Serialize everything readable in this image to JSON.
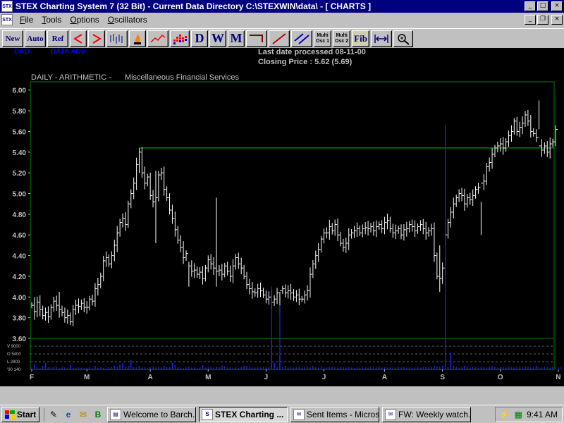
{
  "window": {
    "title": "STEX Charting System 7 (32 Bit)  -  Current Data Directory C:\\STEXWIN\\data\\ - [  CHARTS   ]",
    "min": "_",
    "max": "□",
    "close": "×",
    "doc_min": "_",
    "doc_max": "❐",
    "doc_close": "×"
  },
  "menu": {
    "items": [
      "File",
      "Tools",
      "Options",
      "Oscillators"
    ]
  },
  "toolbar": {
    "new_label": "New",
    "auto_label": "Auto",
    "ref_label": "Ref",
    "d_label": "D",
    "w_label": "W",
    "m_label": "M",
    "multi1_a": "Multi",
    "multi1_b": "Osc 1",
    "multi2_a": "Multi",
    "multi2_b": "Osc 2",
    "fib_label": "Fib"
  },
  "chart_header": {
    "symbol": "DAD",
    "indicator": "DATA ADV",
    "last_date": "Last date processed 08-11-00",
    "closing": "Closing Price : 5.62  (5.69)",
    "mode": "DAILY - ARITHMETIC -",
    "sector": "Miscellaneous Financial Services"
  },
  "colors": {
    "background": "#000000",
    "bars": "#ffffff",
    "grid_frame": "#008000",
    "resistance": "#00c000",
    "volume": "#2020ff",
    "axis_text": "#c0c0c0",
    "header_blue": "#0000ff"
  },
  "chart_data": {
    "type": "ohlc",
    "y_ticks": [
      "6.00",
      "5.80",
      "5.60",
      "5.40",
      "5.20",
      "5.00",
      "4.80",
      "4.60",
      "4.40",
      "4.20",
      "4.00",
      "3.80",
      "3.60"
    ],
    "ylim": [
      3.6,
      6.08
    ],
    "x_months": [
      "F",
      "M",
      "A",
      "M",
      "J",
      "J",
      "A",
      "S",
      "O",
      "N"
    ],
    "month_index": [
      0,
      20,
      43,
      64,
      85,
      106,
      128,
      149,
      170,
      191
    ],
    "resistance_level": 5.44,
    "resistance_start_index": 39,
    "volume_axis_labels": [
      "V 9000",
      "O 5400",
      "L 2800",
      "'00 140"
    ],
    "closes": [
      3.92,
      3.86,
      3.95,
      3.88,
      3.82,
      3.85,
      3.81,
      3.9,
      3.96,
      3.92,
      3.88,
      3.85,
      3.8,
      3.82,
      3.76,
      3.88,
      3.92,
      3.91,
      3.94,
      3.9,
      3.9,
      3.98,
      3.96,
      4.08,
      4.12,
      4.2,
      4.35,
      4.38,
      4.32,
      4.4,
      4.5,
      4.62,
      4.72,
      4.76,
      4.7,
      4.9,
      5.0,
      5.1,
      5.28,
      5.4,
      5.2,
      5.1,
      5.16,
      4.98,
      4.92,
      4.96,
      5.18,
      5.2,
      5.04,
      4.96,
      4.84,
      4.76,
      4.65,
      4.55,
      4.48,
      4.38,
      4.42,
      4.3,
      4.25,
      4.26,
      4.22,
      4.24,
      4.18,
      4.28,
      4.36,
      4.32,
      4.28,
      4.25,
      4.26,
      4.22,
      4.3,
      4.25,
      4.2,
      4.3,
      4.38,
      4.32,
      4.28,
      4.2,
      4.12,
      4.08,
      4.05,
      4.04,
      4.08,
      4.06,
      4.02,
      3.98,
      4.0,
      3.95,
      3.98,
      4.04,
      4.06,
      4.08,
      4.04,
      4.06,
      4.04,
      4.0,
      4.02,
      3.98,
      3.98,
      4.02,
      4.06,
      4.22,
      4.32,
      4.4,
      4.46,
      4.56,
      4.62,
      4.62,
      4.68,
      4.64,
      4.7,
      4.6,
      4.52,
      4.48,
      4.52,
      4.6,
      4.62,
      4.64,
      4.66,
      4.62,
      4.66,
      4.67,
      4.66,
      4.68,
      4.64,
      4.68,
      4.7,
      4.66,
      4.72,
      4.74,
      4.66,
      4.62,
      4.64,
      4.66,
      4.6,
      4.65,
      4.66,
      4.7,
      4.68,
      4.64,
      4.68,
      4.7,
      4.66,
      4.62,
      4.64,
      4.66,
      4.4,
      4.2,
      4.18,
      4.28,
      4.6,
      4.72,
      4.82,
      4.9,
      4.96,
      5.0,
      4.98,
      4.9,
      4.96,
      4.94,
      4.98,
      5.04,
      5.06,
      5.1,
      5.12,
      5.26,
      5.3,
      5.38,
      5.44,
      5.46,
      5.48,
      5.44,
      5.5,
      5.56,
      5.6,
      5.7,
      5.6,
      5.64,
      5.68,
      5.76,
      5.7,
      5.6,
      5.58,
      5.54,
      5.46,
      5.42,
      5.46,
      5.4,
      5.48,
      5.5,
      5.62
    ],
    "volume": [
      0.05,
      0.15,
      0.05,
      0.03,
      0.1,
      0.2,
      0.05,
      0.04,
      0.06,
      0.05,
      0.02,
      0.05,
      0.04,
      0.02,
      0.12,
      0.03,
      0.02,
      0.05,
      0.04,
      0.03,
      0.02,
      0.06,
      0.03,
      0.1,
      0.03,
      0.05,
      0.03,
      0.02,
      0.05,
      0.06,
      0.1,
      0.05,
      0.12,
      0.2,
      0.06,
      0.1,
      0.3,
      0.05,
      0.04,
      0.1,
      0.05,
      0.05,
      0.02,
      0.05,
      0.06,
      0.04,
      0.05,
      0.04,
      0.1,
      0.05,
      0.04,
      0.2,
      0.12,
      0.05,
      0.04,
      0.02,
      0.05,
      0.06,
      0.04,
      0.05,
      0.02,
      0.04,
      0.12,
      0.04,
      0.05,
      0.06,
      0.04,
      0.06,
      0.05,
      0.1,
      0.08,
      0.04,
      0.05,
      0.04,
      0.06,
      0.04,
      0.05,
      0.1,
      0.08,
      0.05,
      0.04,
      0.04,
      0.05,
      0.04,
      0.05,
      0.05,
      0.05,
      1.0,
      0.2,
      0.05,
      0.45,
      0.05,
      0.1,
      0.04,
      0.05,
      0.04,
      0.05,
      0.06,
      0.04,
      0.05,
      0.05,
      0.04,
      0.1,
      0.05,
      0.04,
      0.06,
      0.05,
      0.04,
      0.05,
      0.06,
      0.05,
      0.04,
      0.06,
      0.05,
      0.04,
      0.05,
      0.04,
      0.03,
      0.05,
      0.04,
      0.05,
      0.04,
      0.04,
      0.06,
      0.05,
      0.04,
      0.06,
      0.04,
      0.05,
      0.04,
      0.05,
      0.04,
      0.04,
      0.05,
      0.04,
      0.05,
      0.04,
      0.05,
      0.04,
      0.04,
      0.05,
      0.04,
      0.05,
      0.05,
      0.04,
      0.05,
      0.1,
      0.08,
      0.06,
      0.1,
      0.05,
      0.05,
      0.55,
      0.1,
      0.06,
      0.04,
      0.05,
      0.1,
      0.06,
      0.04,
      0.06,
      0.05,
      0.04,
      0.06,
      0.05,
      0.04,
      0.06,
      0.08,
      0.06,
      0.04,
      0.06,
      0.05,
      0.04,
      0.06,
      0.05,
      0.04,
      0.06,
      0.05,
      0.04,
      0.08,
      0.06,
      0.04,
      0.05,
      0.1,
      0.05,
      0.04,
      0.06,
      0.05,
      0.04,
      0.06,
      0.05,
      0.04,
      0.05
    ],
    "spikes": [
      {
        "index": 1,
        "high": 4.0,
        "low": 3.78
      },
      {
        "index": 10,
        "high": 4.05,
        "low": 3.8
      },
      {
        "index": 39,
        "high": 5.44,
        "low": 5.2
      },
      {
        "index": 45,
        "high": 5.22,
        "low": 4.52
      },
      {
        "index": 57,
        "high": 4.34,
        "low": 4.1
      },
      {
        "index": 67,
        "high": 4.96,
        "low": 4.1
      },
      {
        "index": 90,
        "high": 4.05,
        "low": 3.84
      },
      {
        "index": 148,
        "high": 4.5,
        "low": 4.05
      },
      {
        "index": 150,
        "high": 4.72,
        "low": 4.5
      },
      {
        "index": 163,
        "high": 4.92,
        "low": 4.6
      },
      {
        "index": 184,
        "high": 5.9,
        "low": 5.62
      }
    ]
  },
  "taskbar": {
    "start": "Start",
    "tasks": [
      "Welcome to Barch...",
      "STEX Charting ...",
      "Sent Items - Micros...",
      "FW: Weekly watch..."
    ],
    "clock": "9:41 AM"
  }
}
